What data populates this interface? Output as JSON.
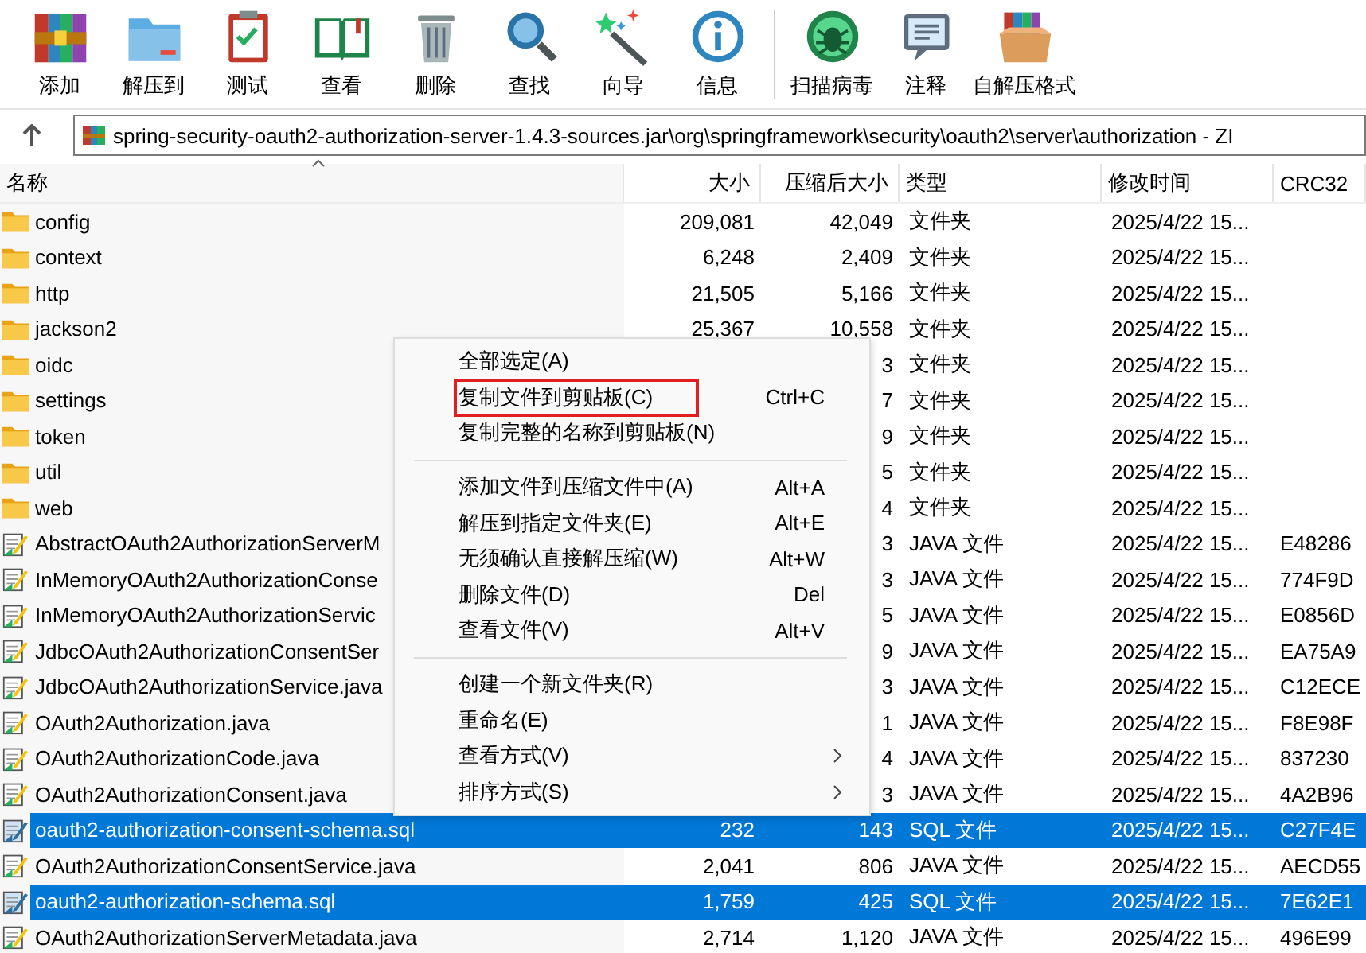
{
  "toolbar": {
    "groups": [
      [
        {
          "label": "添加"
        },
        {
          "label": "解压到"
        },
        {
          "label": "测试"
        },
        {
          "label": "查看"
        },
        {
          "label": "删除"
        },
        {
          "label": "查找"
        },
        {
          "label": "向导"
        },
        {
          "label": "信息"
        }
      ],
      [
        {
          "label": "扫描病毒"
        },
        {
          "label": "注释"
        },
        {
          "label": "自解压格式"
        }
      ]
    ]
  },
  "address": {
    "path": "spring-security-oauth2-authorization-server-1.4.3-sources.jar\\org\\springframework\\security\\oauth2\\server\\authorization - ZI"
  },
  "table": {
    "columns": [
      {
        "label": "名称",
        "sorted": true
      },
      {
        "label": "大小",
        "sorted": false
      },
      {
        "label": "压缩后大小",
        "sorted": false
      },
      {
        "label": "类型",
        "sorted": false
      },
      {
        "label": "修改时间",
        "sorted": false
      },
      {
        "label": "CRC32",
        "sorted": false
      }
    ],
    "rows": [
      {
        "kind": "folder",
        "name": "config",
        "size": "209,081",
        "packed": "42,049",
        "type": "文件夹",
        "modified": "2025/4/22 15...",
        "selected": false
      },
      {
        "kind": "folder",
        "name": "context",
        "size": "6,248",
        "packed": "2,409",
        "type": "文件夹",
        "modified": "2025/4/22 15...",
        "selected": false
      },
      {
        "kind": "folder",
        "name": "http",
        "size": "21,505",
        "packed": "5,166",
        "type": "文件夹",
        "modified": "2025/4/22 15...",
        "selected": false
      },
      {
        "kind": "folder",
        "name": "jackson2",
        "size": "25,367",
        "packed": "10,558",
        "type": "文件夹",
        "modified": "2025/4/22 15...",
        "selected": false
      },
      {
        "kind": "folder",
        "name": "oidc",
        "packed": "3",
        "type": "文件夹",
        "modified": "2025/4/22 15...",
        "selected": false
      },
      {
        "kind": "folder",
        "name": "settings",
        "packed": "7",
        "type": "文件夹",
        "modified": "2025/4/22 15...",
        "selected": false
      },
      {
        "kind": "folder",
        "name": "token",
        "packed": "9",
        "type": "文件夹",
        "modified": "2025/4/22 15...",
        "selected": false
      },
      {
        "kind": "folder",
        "name": "util",
        "packed": "5",
        "type": "文件夹",
        "modified": "2025/4/22 15...",
        "selected": false
      },
      {
        "kind": "folder",
        "name": "web",
        "packed": "4",
        "type": "文件夹",
        "modified": "2025/4/22 15...",
        "selected": false
      },
      {
        "kind": "file",
        "name": "AbstractOAuth2AuthorizationServerM",
        "packed": "3",
        "type": "JAVA 文件",
        "modified": "2025/4/22 15...",
        "crc": "E48286",
        "selected": false
      },
      {
        "kind": "file",
        "name": "InMemoryOAuth2AuthorizationConse",
        "packed": "3",
        "type": "JAVA 文件",
        "modified": "2025/4/22 15...",
        "crc": "774F9D",
        "selected": false
      },
      {
        "kind": "file",
        "name": "InMemoryOAuth2AuthorizationServic",
        "packed": "5",
        "type": "JAVA 文件",
        "modified": "2025/4/22 15...",
        "crc": "E0856D",
        "selected": false
      },
      {
        "kind": "file",
        "name": "JdbcOAuth2AuthorizationConsentSer",
        "packed": "9",
        "type": "JAVA 文件",
        "modified": "2025/4/22 15...",
        "crc": "EA75A9",
        "selected": false
      },
      {
        "kind": "file",
        "name": "JdbcOAuth2AuthorizationService.java",
        "packed": "3",
        "type": "JAVA 文件",
        "modified": "2025/4/22 15...",
        "crc": "C12ECE",
        "selected": false
      },
      {
        "kind": "file",
        "name": "OAuth2Authorization.java",
        "packed": "1",
        "type": "JAVA 文件",
        "modified": "2025/4/22 15...",
        "crc": "F8E98F",
        "selected": false
      },
      {
        "kind": "file",
        "name": "OAuth2AuthorizationCode.java",
        "packed": "4",
        "type": "JAVA 文件",
        "modified": "2025/4/22 15...",
        "crc": "837230",
        "selected": false
      },
      {
        "kind": "file",
        "name": "OAuth2AuthorizationConsent.java",
        "packed": "3",
        "type": "JAVA 文件",
        "modified": "2025/4/22 15...",
        "crc": "4A2B96",
        "selected": false
      },
      {
        "kind": "file",
        "name": "oauth2-authorization-consent-schema.sql",
        "size": "232",
        "packed": "143",
        "type": "SQL 文件",
        "modified": "2025/4/22 15...",
        "crc": "C27F4E",
        "selected": true
      },
      {
        "kind": "file",
        "name": "OAuth2AuthorizationConsentService.java",
        "size": "2,041",
        "packed": "806",
        "type": "JAVA 文件",
        "modified": "2025/4/22 15...",
        "crc": "AECD55",
        "selected": false
      },
      {
        "kind": "file",
        "name": "oauth2-authorization-schema.sql",
        "size": "1,759",
        "packed": "425",
        "type": "SQL 文件",
        "modified": "2025/4/22 15...",
        "crc": "7E62E1",
        "selected": true
      },
      {
        "kind": "file",
        "name": "OAuth2AuthorizationServerMetadata.java",
        "size": "2,714",
        "packed": "1,120",
        "type": "JAVA 文件",
        "modified": "2025/4/22 15...",
        "crc": "496E99",
        "selected": false
      }
    ]
  },
  "context_menu": {
    "items": [
      {
        "kind": "item",
        "label": "全部选定(A)",
        "highlighted": false,
        "submenu": false
      },
      {
        "kind": "item",
        "label": "复制文件到剪贴板(C)",
        "shortcut": "Ctrl+C",
        "highlighted": true,
        "submenu": false
      },
      {
        "kind": "item",
        "label": "复制完整的名称到剪贴板(N)",
        "highlighted": false,
        "submenu": false
      },
      {
        "kind": "separator"
      },
      {
        "kind": "item",
        "label": "添加文件到压缩文件中(A)",
        "shortcut": "Alt+A",
        "highlighted": false,
        "submenu": false
      },
      {
        "kind": "item",
        "label": "解压到指定文件夹(E)",
        "shortcut": "Alt+E",
        "highlighted": false,
        "submenu": false
      },
      {
        "kind": "item",
        "label": "无须确认直接解压缩(W)",
        "shortcut": "Alt+W",
        "highlighted": false,
        "submenu": false
      },
      {
        "kind": "item",
        "label": "删除文件(D)",
        "shortcut": "Del",
        "highlighted": false,
        "submenu": false
      },
      {
        "kind": "item",
        "label": "查看文件(V)",
        "shortcut": "Alt+V",
        "highlighted": false,
        "submenu": false
      },
      {
        "kind": "separator"
      },
      {
        "kind": "item",
        "label": "创建一个新文件夹(R)",
        "highlighted": false,
        "submenu": false
      },
      {
        "kind": "item",
        "label": "重命名(E)",
        "highlighted": false,
        "submenu": false
      },
      {
        "kind": "item",
        "label": "查看方式(V)",
        "submenu": true,
        "highlighted": false
      },
      {
        "kind": "item",
        "label": "排序方式(S)",
        "submenu": true,
        "highlighted": false
      }
    ]
  }
}
